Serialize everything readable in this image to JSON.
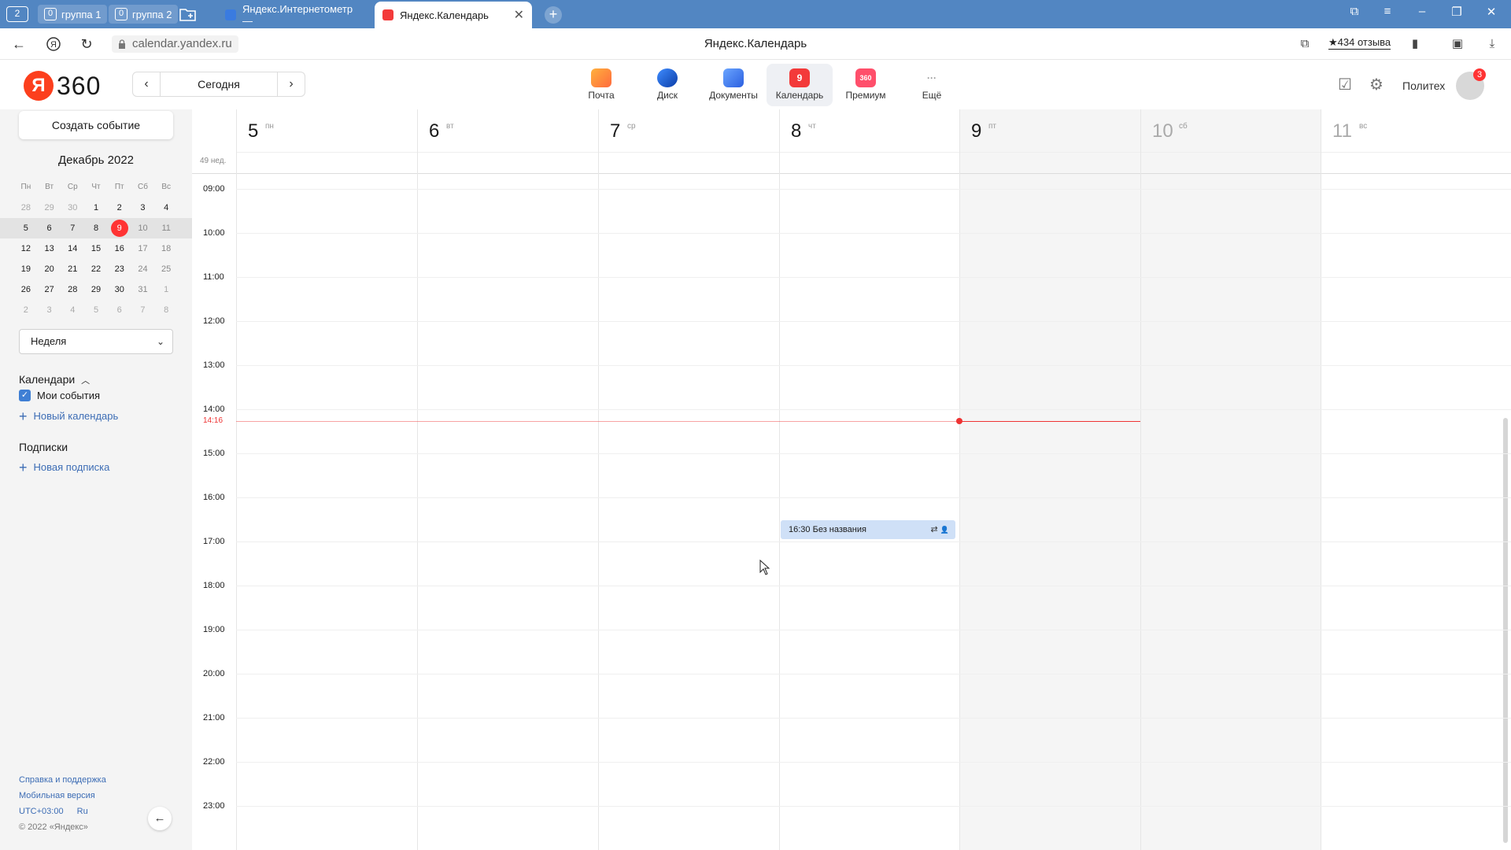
{
  "browser": {
    "tab_counter": "2",
    "groups": [
      {
        "count": "0",
        "label": "группа 1"
      },
      {
        "count": "0",
        "label": "группа 2"
      }
    ],
    "tabs": [
      {
        "title": "Яндекс.Интернетометр —",
        "active": false
      },
      {
        "title": "Яндекс.Календарь",
        "active": true
      }
    ],
    "url": "calendar.yandex.ru",
    "page_title": "Яндекс.Календарь",
    "reviews": "★434 отзыва"
  },
  "header": {
    "logo_letter": "Я",
    "logo_text": "360",
    "today_label": "Сегодня",
    "services": [
      {
        "label": "Почта",
        "icon": "mail-icon",
        "color": "#ff8a3d",
        "badge": ""
      },
      {
        "label": "Диск",
        "icon": "disk-icon",
        "color": "#1e6fe0",
        "badge": ""
      },
      {
        "label": "Документы",
        "icon": "documents-icon",
        "color": "#3b82f6",
        "badge": ""
      },
      {
        "label": "Календарь",
        "icon": "calendar-icon",
        "color": "#f33a3a",
        "badge": "9"
      },
      {
        "label": "Премиум",
        "icon": "premium-icon",
        "color": "#ff4f6b",
        "badge": "360"
      },
      {
        "label": "Ещё",
        "icon": "more-icon",
        "color": "#ffffff",
        "badge": "···"
      }
    ],
    "profile_name": "Политех",
    "notifications": "3"
  },
  "sidebar": {
    "create_button": "Создать событие",
    "month_title": "Декабрь 2022",
    "weekdays": [
      "Пн",
      "Вт",
      "Ср",
      "Чт",
      "Пт",
      "Сб",
      "Вс"
    ],
    "weeks": [
      [
        "28",
        "29",
        "30",
        "1",
        "2",
        "3",
        "4"
      ],
      [
        "5",
        "6",
        "7",
        "8",
        "9",
        "10",
        "11"
      ],
      [
        "12",
        "13",
        "14",
        "15",
        "16",
        "17",
        "18"
      ],
      [
        "19",
        "20",
        "21",
        "22",
        "23",
        "24",
        "25"
      ],
      [
        "26",
        "27",
        "28",
        "29",
        "30",
        "31",
        "1"
      ],
      [
        "2",
        "3",
        "4",
        "5",
        "6",
        "7",
        "8"
      ]
    ],
    "view_select": "Неделя",
    "calendars_title": "Календари",
    "my_events": "Мои события",
    "new_calendar": "Новый календарь",
    "subscriptions_title": "Подписки",
    "new_subscription": "Новая подписка",
    "footer": {
      "help": "Справка и поддержка",
      "mobile": "Мобильная версия",
      "timezone": "UTC+03:00",
      "lang": "Ru",
      "copyright": "© 2022 «Яндекс»"
    }
  },
  "week_view": {
    "week_label": "49 нед.",
    "days": [
      {
        "num": "5",
        "dow": "пн",
        "weekend": false
      },
      {
        "num": "6",
        "dow": "вт",
        "weekend": false
      },
      {
        "num": "7",
        "dow": "ср",
        "weekend": false
      },
      {
        "num": "8",
        "dow": "чт",
        "weekend": false
      },
      {
        "num": "9",
        "dow": "пт",
        "weekend": false
      },
      {
        "num": "10",
        "dow": "сб",
        "weekend": true
      },
      {
        "num": "11",
        "dow": "вс",
        "weekend": true
      }
    ],
    "hours": [
      "09:00",
      "10:00",
      "11:00",
      "12:00",
      "13:00",
      "14:00",
      "15:00",
      "16:00",
      "17:00",
      "18:00",
      "19:00",
      "20:00",
      "21:00",
      "22:00",
      "23:00"
    ],
    "now_label": "14:16",
    "event": {
      "time": "16:30",
      "title": "Без названия",
      "day": "8"
    }
  }
}
